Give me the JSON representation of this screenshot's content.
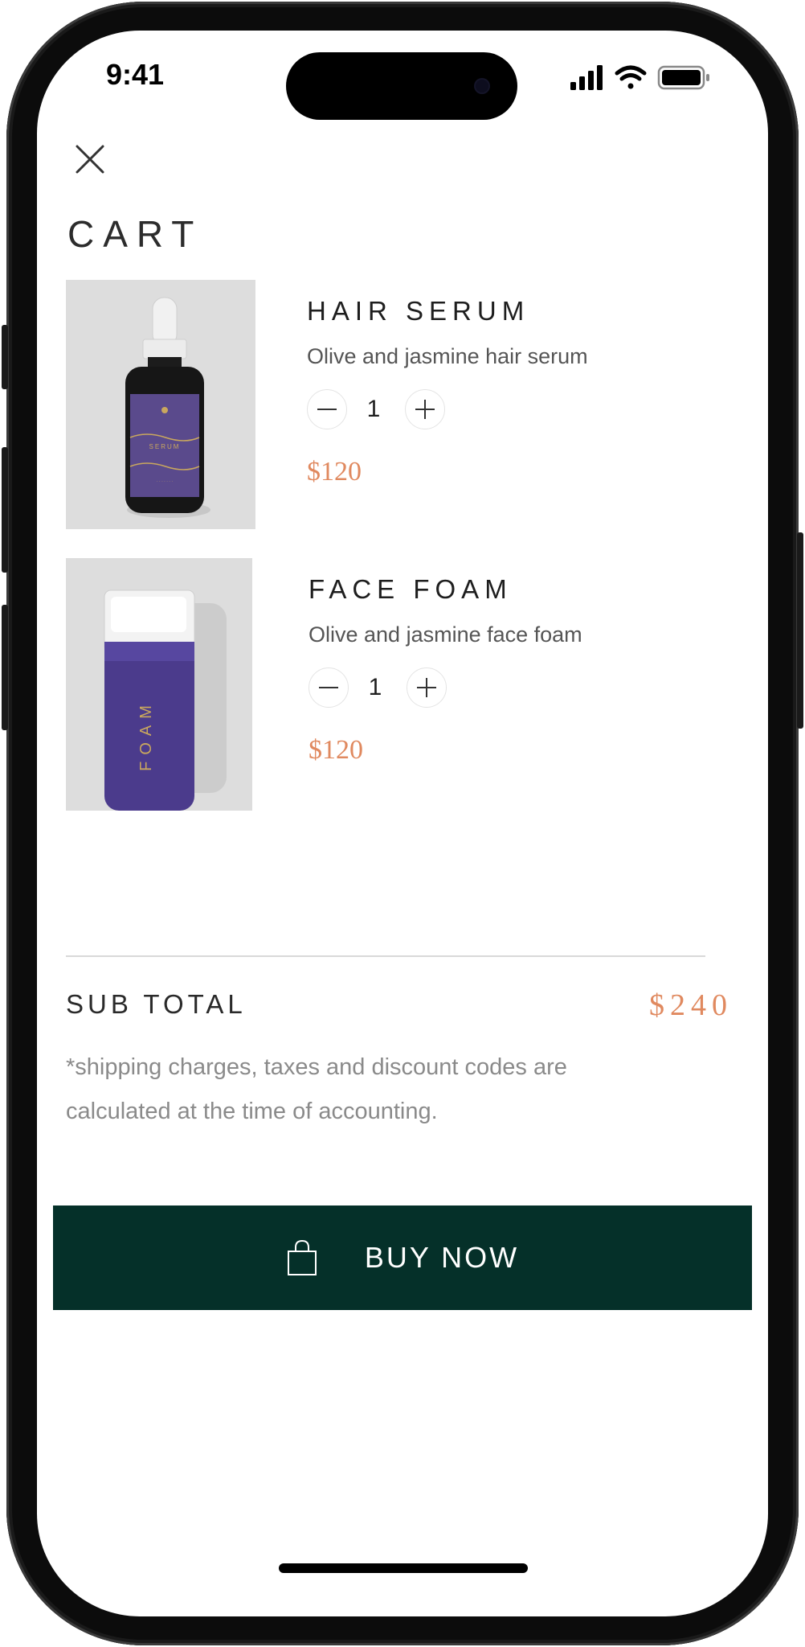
{
  "status_bar": {
    "time": "9:41"
  },
  "page": {
    "title": "CART"
  },
  "cart_items": [
    {
      "name": "HAIR SERUM",
      "description": "Olive and jasmine hair serum",
      "quantity": "1",
      "price": "$120",
      "image": "serum-bottle-image"
    },
    {
      "name": "FACE FOAM",
      "description": "Olive and jasmine face foam",
      "quantity": "1",
      "price": "$120",
      "image": "foam-pump-bottle-image"
    }
  ],
  "summary": {
    "subtotal_label": "SUB TOTAL",
    "subtotal_value": "$240",
    "note": "*shipping charges, taxes and discount codes are calculated at the time of accounting."
  },
  "cta": {
    "label": "BUY NOW",
    "icon": "shopping-bag-icon"
  },
  "colors": {
    "accent": "#E0895F",
    "button": "#053029",
    "text": "#1E1E1E"
  },
  "icons": [
    "close-icon",
    "minus-icon",
    "plus-icon",
    "shopping-bag-icon",
    "signal-icon",
    "wifi-icon",
    "battery-icon"
  ]
}
